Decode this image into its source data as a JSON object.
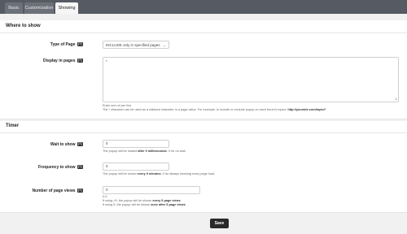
{
  "tabs": [
    {
      "label": "Basic",
      "active": false
    },
    {
      "label": "Customization",
      "active": false
    },
    {
      "label": "Showing",
      "active": true
    }
  ],
  "where_to_show": {
    "title": "Where to show",
    "type_of_page": {
      "label": "Type of Page",
      "help": "[?]",
      "value": "INCLUDE only in specified pages"
    },
    "display_in_pages": {
      "label": "Display in pages",
      "help": "[?]",
      "value": "*",
      "hint_line1": "Enter one url per line",
      "hint_line2_prefix": "The * character can be used as a wildcard character in a page value. For example, to include or exclude popup on each forum's topics: ",
      "hint_line2_example": "http://yoursite.com/topic/*"
    }
  },
  "timer": {
    "title": "Timer",
    "wait_to_show": {
      "label": "Wait to show",
      "help": "[?]",
      "value": "0",
      "hint_prefix": "The popup will be loaded ",
      "hint_bold": "after 0 milliseconds",
      "hint_suffix": ". 0 for no wait."
    },
    "frequency": {
      "label": "Frequency to show",
      "help": "[?]",
      "value": "0",
      "hint_prefix": "The popup will be shown ",
      "hint_bold": "every 0 minutes",
      "hint_suffix": ". 0 for always showing every page load."
    },
    "page_views": {
      "label": "Number of page views",
      "help": "[?]",
      "value": "0",
      "hint1": "0-5",
      "hint2_prefix": "If using >5, the popup will be shown ",
      "hint2_bold": "every 5 page views",
      "hint3_prefix": "If using 5, the popup will be shown ",
      "hint3_bold": "once after 5 page views"
    }
  },
  "save_label": "Save",
  "icons": {
    "select_chevron": "chevron-down-icon",
    "resize_handle": "resize-handle-icon"
  }
}
